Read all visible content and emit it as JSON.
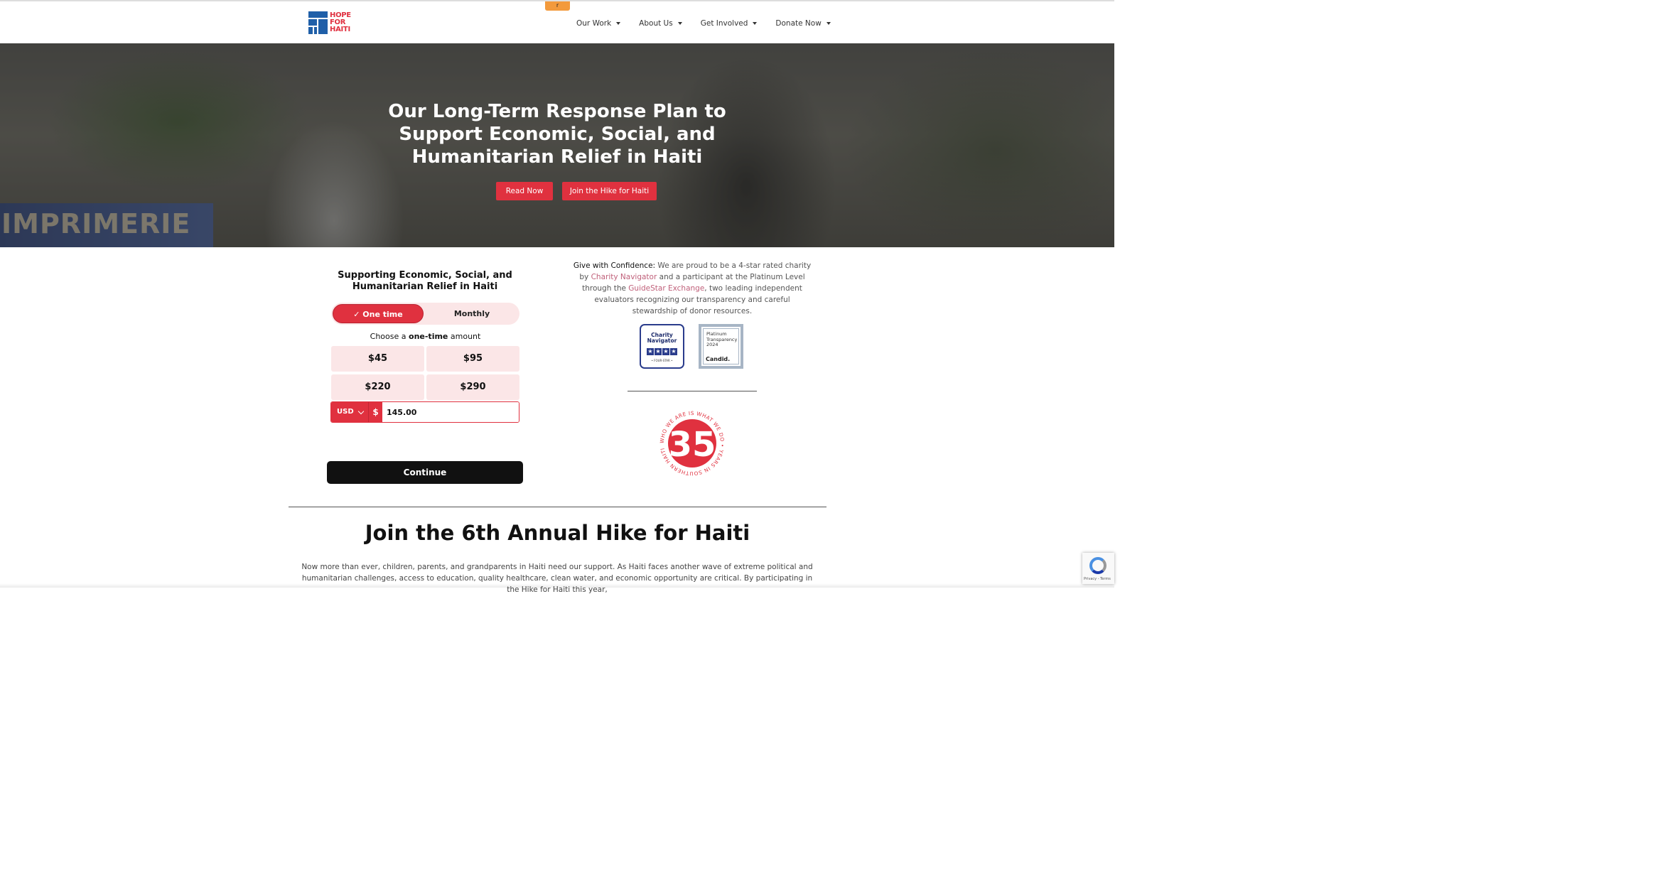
{
  "header": {
    "tab_handle": "r",
    "logo": {
      "line1": "HOPE",
      "line2": "FOR",
      "line3": "HAITI"
    },
    "nav": [
      {
        "label": "Our Work"
      },
      {
        "label": "About Us"
      },
      {
        "label": "Get Involved"
      },
      {
        "label": "Donate Now"
      }
    ]
  },
  "hero": {
    "sign_text": "IMPRIMERIE",
    "title": "Our Long-Term Response Plan to Support Economic, Social, and Humanitarian Relief in Haiti",
    "buttons": {
      "read_now": "Read Now",
      "join_hike": "Join the Hike for Haiti"
    }
  },
  "donation": {
    "title": "Supporting Economic, Social, and Humanitarian Relief in Haiti",
    "frequency": {
      "one_time": "✓ One time",
      "monthly": "Monthly",
      "selected": "One time"
    },
    "choose_prefix": "Choose a ",
    "choose_bold": "one-time",
    "choose_suffix": " amount",
    "amounts": [
      "$45",
      "$95",
      "$220",
      "$290"
    ],
    "currency": "USD",
    "currency_symbol": "$",
    "amount_value": "145.00",
    "continue": "Continue"
  },
  "confidence": {
    "lead": "Give with Confidence:",
    "text1": " We are proud to be a 4-star rated charity by ",
    "link1": "Charity Navigator",
    "text2": " and a participant at the Platinum Level through the ",
    "link2": "GuideStar Exchange",
    "text3": ", two leading independent evaluators recognizing our transparency and careful stewardship of donor resources."
  },
  "badges": {
    "charity_navigator": {
      "line1": "Charity",
      "line2": "Navigator",
      "footer": "• FOUR-STAR •"
    },
    "candid": {
      "line1": "Platinum",
      "line2": "Transparency",
      "line3": "2024",
      "brand": "Candid."
    }
  },
  "seal": {
    "number": "35",
    "ring_text": "WHO WE ARE IS WHAT WE DO • YEARS IN SOUTHERN HAITI"
  },
  "hike": {
    "title": "Join the 6th Annual Hike for Haiti",
    "text": "Now more than ever, children, parents, and grandparents in Haiti need our support. As Haiti faces another wave of extreme political and humanitarian challenges, access to education, quality healthcare, clean water, and economic opportunity are critical. By participating in the Hike for Haiti this year,"
  },
  "recaptcha": {
    "text": "Privacy - Terms"
  },
  "colors": {
    "brand_red": "#e0313f",
    "brand_blue": "#1f5fa8",
    "pink_bg": "#fbe6e7"
  }
}
